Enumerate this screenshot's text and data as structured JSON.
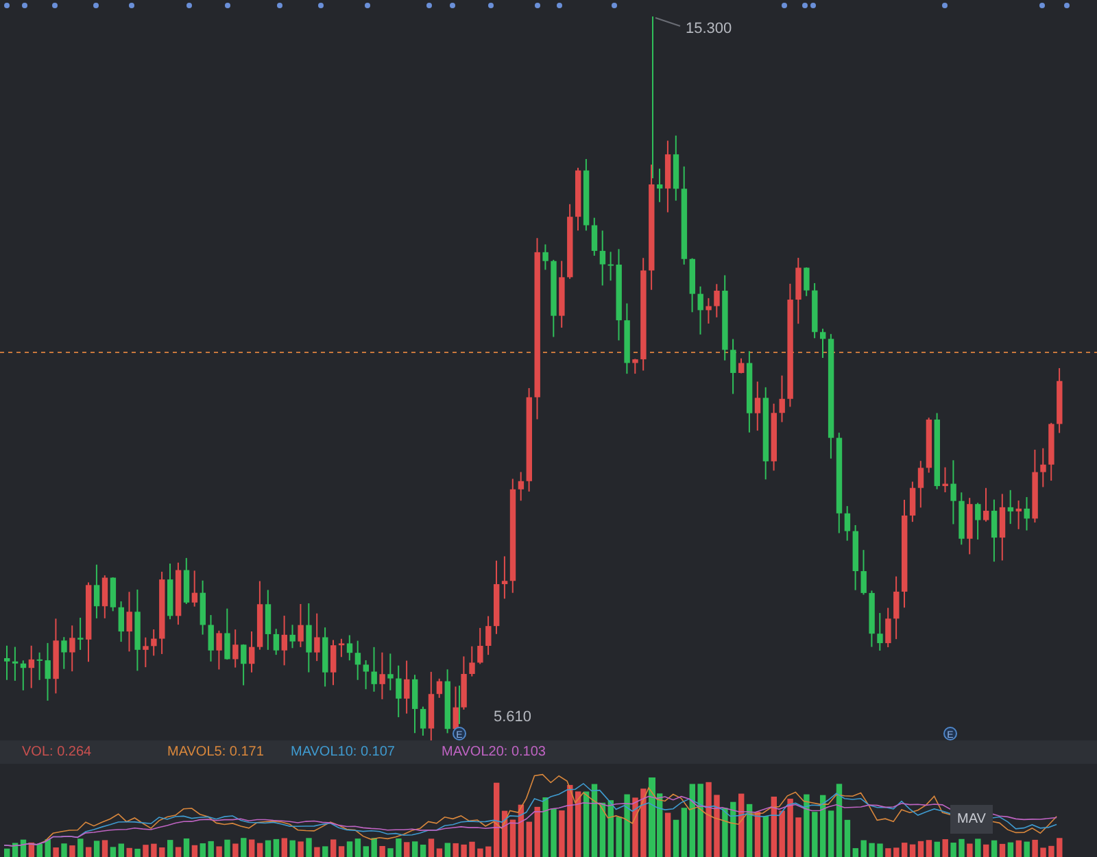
{
  "chart": {
    "high_label": "15.300",
    "low_label": "5.610",
    "event_markers": [
      "E",
      "E"
    ]
  },
  "volume_legend": [
    {
      "label": "VOL: 0.264",
      "color": "#c8504f"
    },
    {
      "label": "MAVOL5: 0.171",
      "color": "#d9873c"
    },
    {
      "label": "MAVOL10: 0.107",
      "color": "#3f9bd0"
    },
    {
      "label": "MAVOL20: 0.103",
      "color": "#c064c4"
    }
  ],
  "tooltip": "MAV"
}
